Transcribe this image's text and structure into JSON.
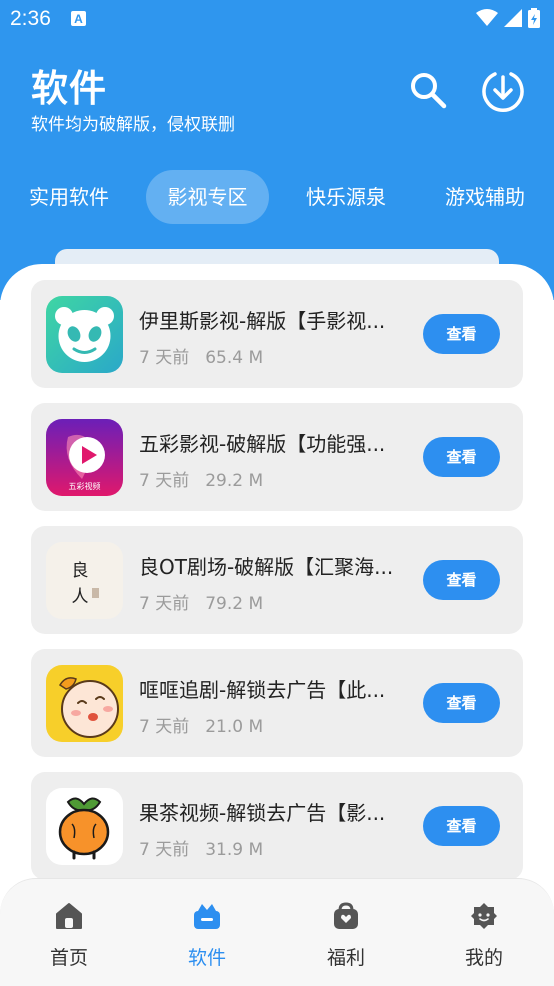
{
  "status_bar": {
    "time": "2:36",
    "notification_glyph": "A"
  },
  "header": {
    "title": "软件",
    "subtitle": "软件均为破解版，侵权联删",
    "icons": [
      "search-icon",
      "download-icon"
    ]
  },
  "tabs": [
    {
      "label": "实用软件",
      "active": false
    },
    {
      "label": "影视专区",
      "active": true
    },
    {
      "label": "快乐源泉",
      "active": false
    },
    {
      "label": "游戏辅助",
      "active": false
    }
  ],
  "apps": [
    {
      "name": "伊里斯影视-解版【手影视...",
      "time": "7 天前",
      "size": "65.4 M",
      "button": "查看",
      "icon": "panda-app-icon"
    },
    {
      "name": "五彩影视-破解版【功能强...",
      "time": "7 天前",
      "size": "29.2 M",
      "button": "查看",
      "icon": "play-app-icon",
      "icon_text": "五彩视频"
    },
    {
      "name": "良OT剧场-破解版【汇聚海...",
      "time": "7 天前",
      "size": "79.2 M",
      "button": "查看",
      "icon": "calligraphy-app-icon",
      "icon_text_top": "良",
      "icon_text_bottom": "人"
    },
    {
      "name": "哐哐追剧-解锁去广告【此...",
      "time": "7 天前",
      "size": "21.0 M",
      "button": "查看",
      "icon": "cartoon-face-app-icon"
    },
    {
      "name": "果茶视频-解锁去广告【影...",
      "time": "7 天前",
      "size": "31.9 M",
      "button": "查看",
      "icon": "fruit-app-icon"
    }
  ],
  "bottom_nav": [
    {
      "label": "首页",
      "icon": "home-icon",
      "active": false
    },
    {
      "label": "软件",
      "icon": "software-icon",
      "active": true
    },
    {
      "label": "福利",
      "icon": "gift-bag-icon",
      "active": false
    },
    {
      "label": "我的",
      "icon": "profile-icon",
      "active": false
    }
  ],
  "colors": {
    "primary": "#2f96ee",
    "button": "#2d8ff0",
    "card": "#eeeeee"
  }
}
